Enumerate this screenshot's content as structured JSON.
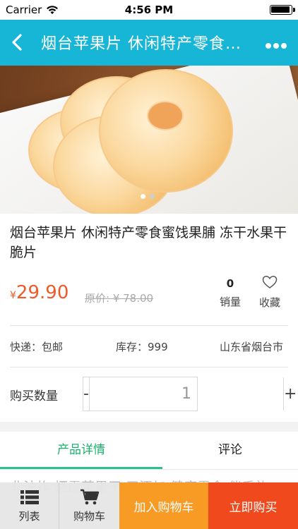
{
  "status_bar": {
    "carrier": "Carrier",
    "time": "4:56 PM"
  },
  "nav": {
    "title": "烟台苹果片 休闲特产零食蜜饯果脯 冻干水果干脆片",
    "bg_color": "#17b5d6"
  },
  "gallery": {
    "page_count": 2,
    "active_page": 1
  },
  "product": {
    "title": "烟台苹果片 休闲特产零食蜜饯果脯 冻干水果干脆片",
    "currency_symbol": "¥",
    "price": "29.90",
    "original_price": "原价: ¥ 78.00",
    "sales_count": "0",
    "sales_label": "销量",
    "favorite_label": "收藏",
    "shipping": "快递：包邮",
    "stock": "库存：999",
    "location": "山东省烟台市"
  },
  "quantity": {
    "label": "购买数量",
    "minus": "-",
    "plus": "+",
    "value": "1"
  },
  "tabs": {
    "details": "产品详情",
    "reviews": "评论",
    "active_color": "#19b26b"
  },
  "description": {
    "text": "非油炸 栖霞苹果干 无添加 健康零食 伴手礼"
  },
  "bottom_bar": {
    "list_label": "列表",
    "cart_label": "购物车",
    "add_to_cart": "加入购物车",
    "buy_now": "立即购买",
    "add_color": "#f79b24",
    "buy_color": "#f0491e"
  },
  "icons": [
    "wifi-icon",
    "battery-icon",
    "back-arrow-icon",
    "more-dots-icon",
    "heart-icon",
    "list-icon",
    "cart-icon"
  ]
}
